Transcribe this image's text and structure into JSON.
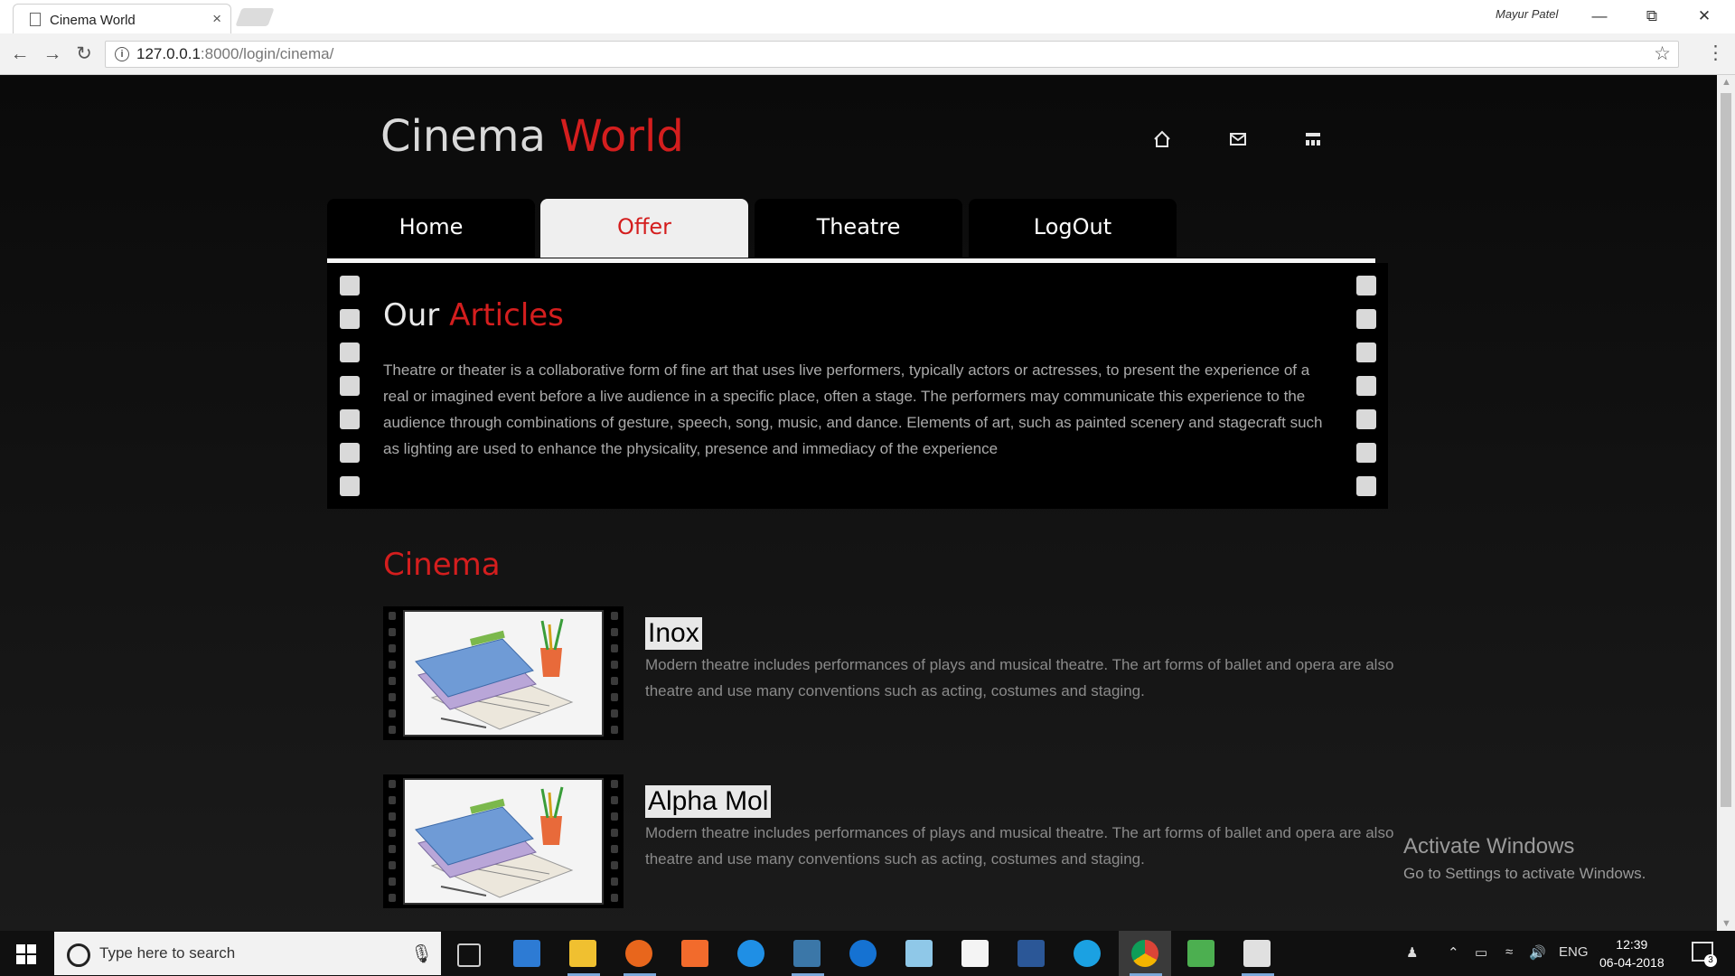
{
  "browser": {
    "tab_title": "Cinema World",
    "tab_close": "×",
    "user": "Mayur Patel",
    "url_host": "127.0.0.1",
    "url_path": ":8000/login/cinema/"
  },
  "site": {
    "logo_main": "Cinema",
    "logo_accent": "World",
    "header_icons": [
      "home-icon",
      "mail-icon",
      "sitemap-icon"
    ],
    "nav": [
      {
        "label": "Home",
        "active": false
      },
      {
        "label": "Offer",
        "active": true
      },
      {
        "label": "Theatre",
        "active": false
      },
      {
        "label": "LogOut",
        "active": false
      }
    ],
    "articles": {
      "title_main": "Our",
      "title_accent": "Articles",
      "text": "Theatre or theater is a collaborative form of fine art that uses live performers, typically actors or actresses, to present the experience of a real or imagined event before a live audience in a specific place, often a stage. The performers may communicate this experience to the audience through combinations of gesture, speech, song, music, and dance. Elements of art, such as painted scenery and stagecraft such as lighting are used to enhance the physicality, presence and immediacy of the experience"
    },
    "cinema_heading": "Cinema",
    "cinemas": [
      {
        "name": "Inox",
        "description": "Modern theatre includes performances of plays and musical theatre. The art forms of ballet and opera are also theatre and use many conventions such as acting, costumes and staging."
      },
      {
        "name": "Alpha Mol",
        "description": "Modern theatre includes performances of plays and musical theatre. The art forms of ballet and opera are also theatre and use many conventions such as acting, costumes and staging."
      }
    ]
  },
  "watermark": {
    "line1": "Activate Windows",
    "line2": "Go to Settings to activate Windows."
  },
  "taskbar": {
    "search_placeholder": "Type here to search",
    "language": "ENG",
    "time": "12:39",
    "date": "06-04-2018",
    "notification_count": "3",
    "apps": [
      "task-view-icon",
      "store-icon",
      "file-explorer-icon",
      "firefox-icon",
      "xampp-icon",
      "internet-explorer-icon",
      "python-icon",
      "edge-icon",
      "notepad-icon",
      "mail-icon",
      "powershell-icon",
      "skype-icon",
      "chrome-icon",
      "editor-icon",
      "notes-icon"
    ]
  }
}
